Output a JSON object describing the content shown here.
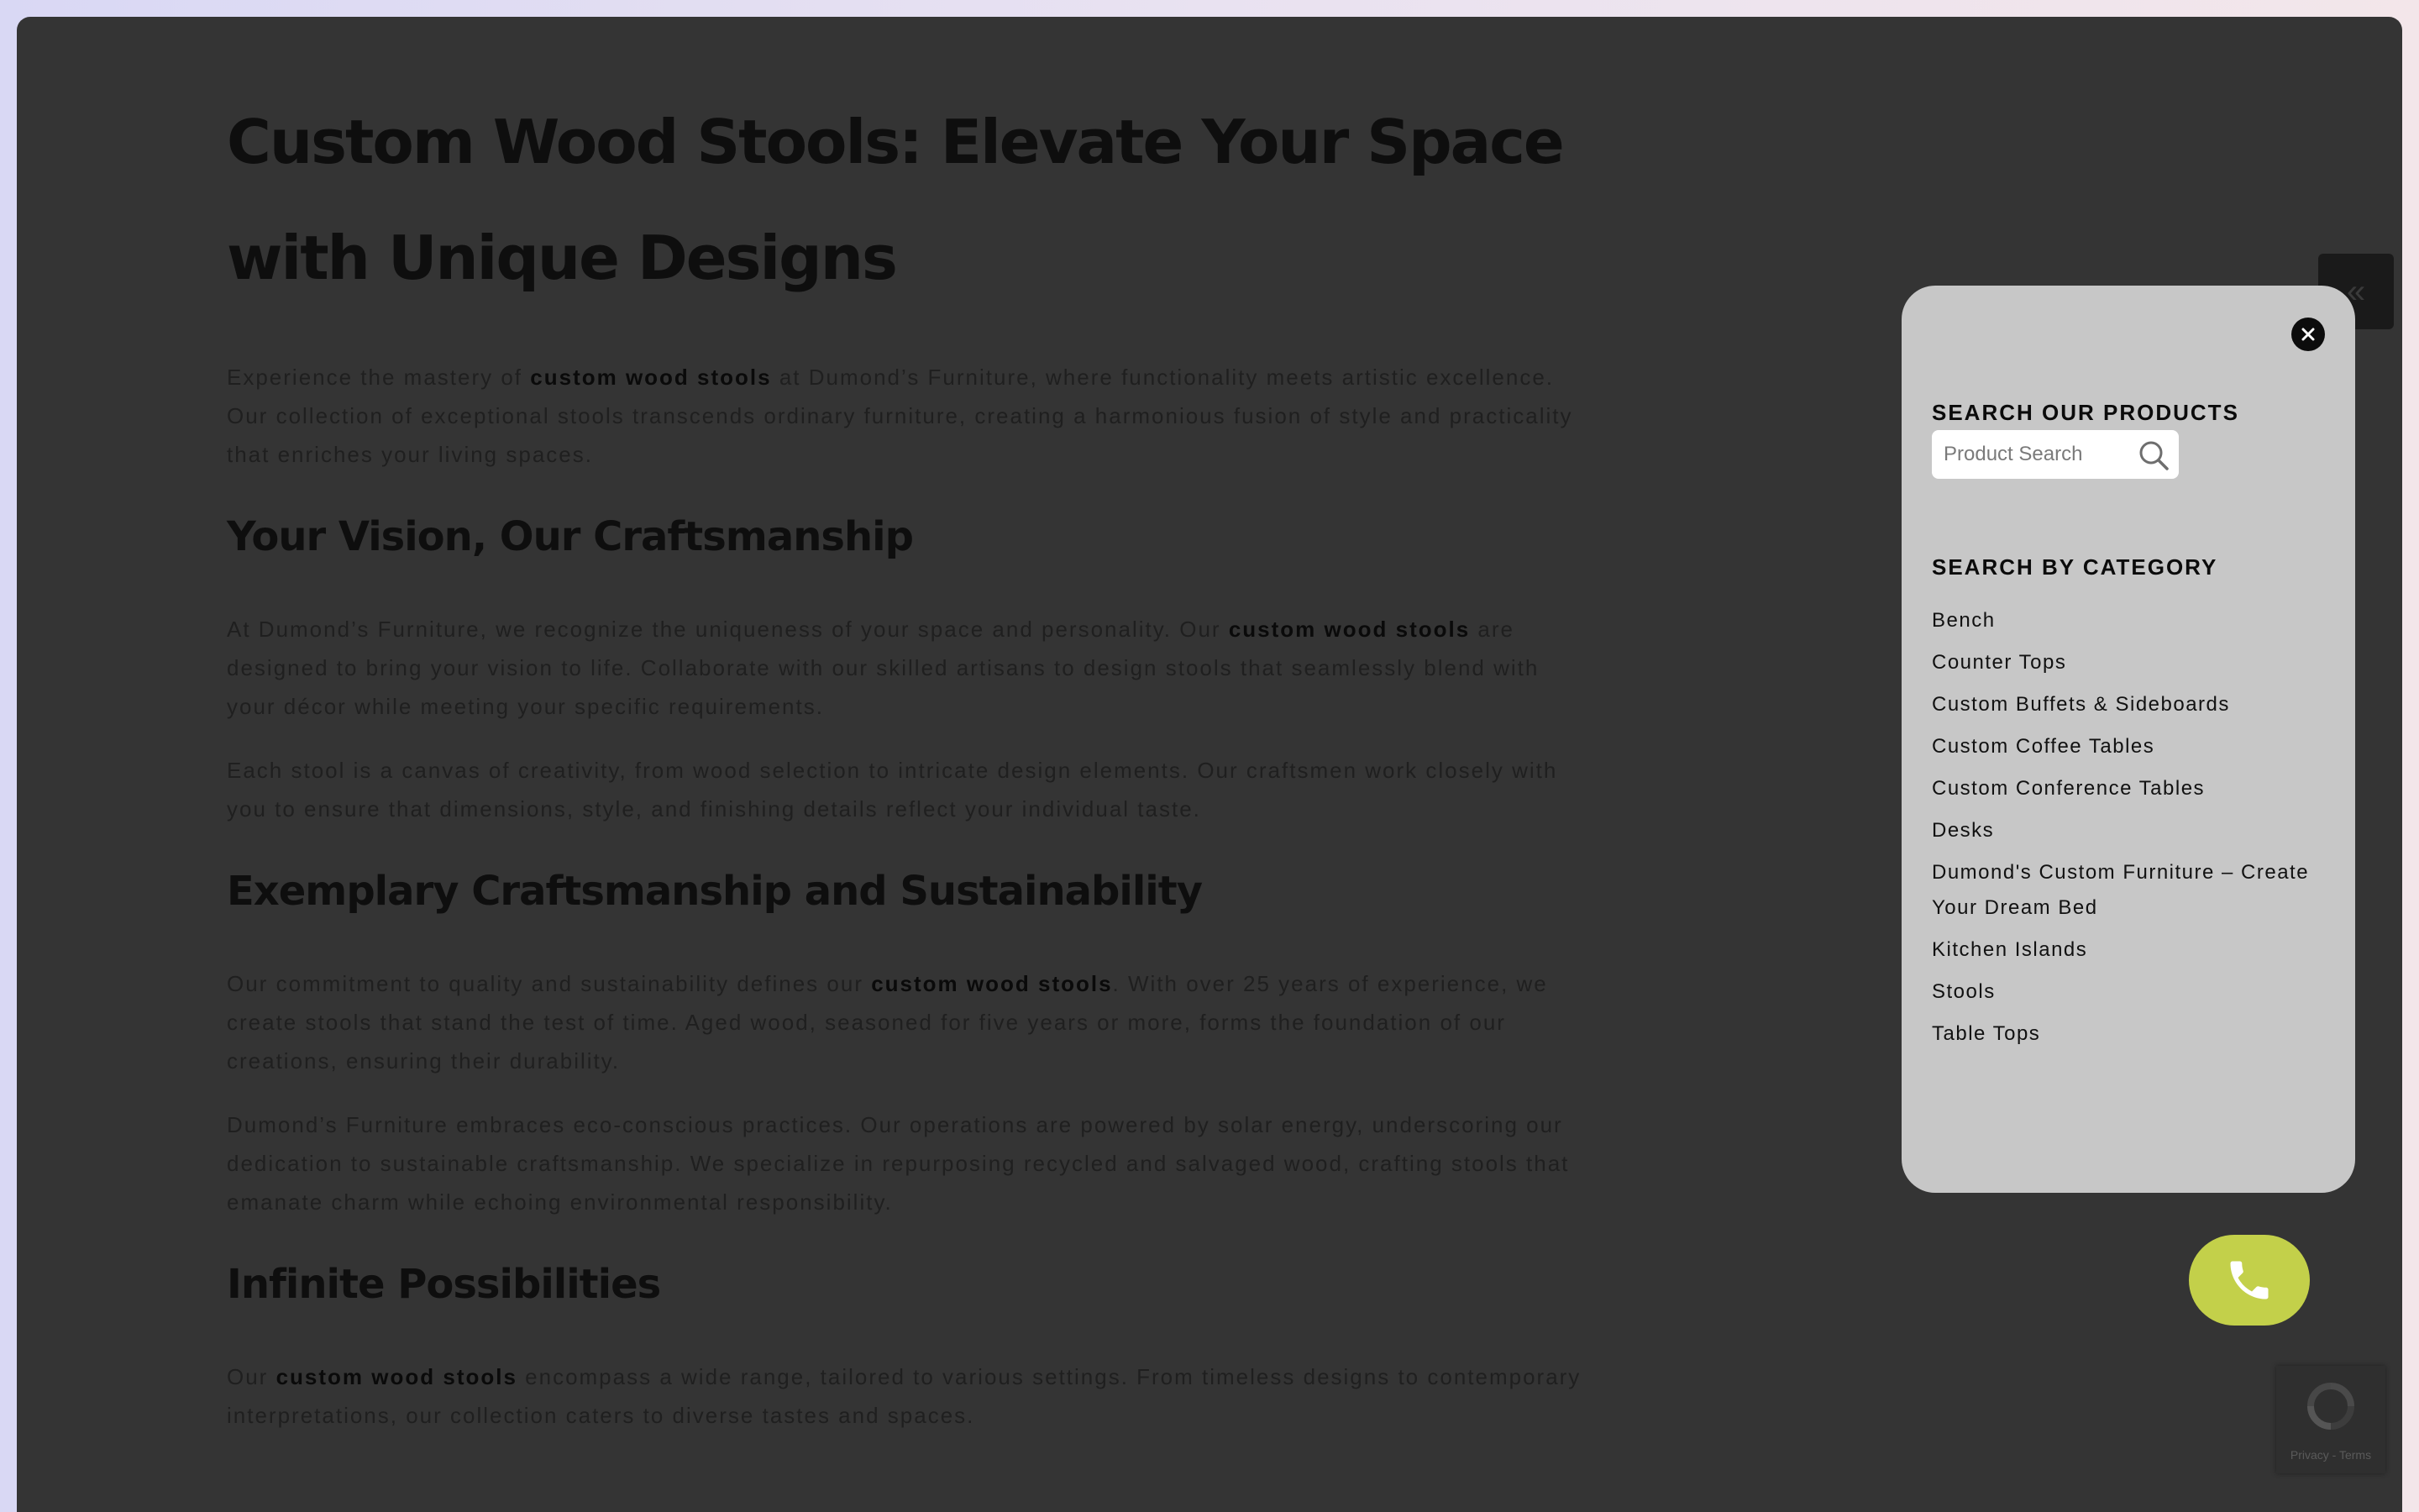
{
  "article": {
    "title": "Custom Wood Stools: Elevate Your Space with Unique Designs",
    "intro": {
      "t1": "Experience the mastery of ",
      "b1": "custom wood stools",
      "t2": " at Dumond’s Furniture, where functionality meets artistic excellence. Our collection of exceptional stools transcends ordinary furniture, creating a harmonious fusion of style and practicality that enriches your living spaces."
    },
    "section1": {
      "heading": "Your Vision, Our Craftsmanship",
      "p1": {
        "t1": "At Dumond’s Furniture, we recognize the uniqueness of your space and personality. Our ",
        "b1": "custom wood stools",
        "t2": " are designed to bring your vision to life. Collaborate with our skilled artisans to design stools that seamlessly blend with your décor while meeting your specific requirements."
      },
      "p2": "Each stool is a canvas of creativity, from wood selection to intricate design elements. Our craftsmen work closely with you to ensure that dimensions, style, and finishing details reflect your individual taste."
    },
    "section2": {
      "heading": "Exemplary Craftsmanship and Sustainability",
      "p1": {
        "t1": "Our commitment to quality and sustainability defines our ",
        "b1": "custom wood stools",
        "t2": ". With over 25 years of experience, we create stools that stand the test of time. Aged wood, seasoned for five years or more, forms the foundation of our creations, ensuring their durability."
      },
      "p2": "Dumond’s Furniture embraces eco-conscious practices. Our operations are powered by solar energy, underscoring our dedication to sustainable craftsmanship. We specialize in repurposing recycled and salvaged wood, crafting stools that emanate charm while echoing environmental responsibility."
    },
    "section3": {
      "heading": "Infinite Possibilities",
      "p1": {
        "t1": "Our ",
        "b1": "custom wood stools",
        "t2": " encompass a wide range, tailored to various settings. From timeless designs to contemporary interpretations, our collection caters to diverse tastes and spaces."
      }
    }
  },
  "side_toggle": {
    "glyph": "«"
  },
  "search_panel": {
    "products_heading": "SEARCH OUR PRODUCTS",
    "search_placeholder": "Product Search",
    "category_heading": "SEARCH BY CATEGORY",
    "categories": [
      "Bench",
      "Counter Tops",
      "Custom Buffets & Sideboards",
      "Custom Coffee Tables",
      "Custom Conference Tables",
      "Desks",
      "Dumond's Custom Furniture – Create Your Dream Bed",
      "Kitchen Islands",
      "Stools",
      "Table Tops"
    ]
  },
  "recaptcha": {
    "text": "Privacy - Terms"
  },
  "colors": {
    "overlay": "#343434",
    "panel": "#c7c7c7",
    "call_button": "#c3d04a"
  },
  "icons": [
    "chevrons-left-icon",
    "close-icon",
    "search-icon",
    "phone-icon",
    "recaptcha-icon"
  ]
}
